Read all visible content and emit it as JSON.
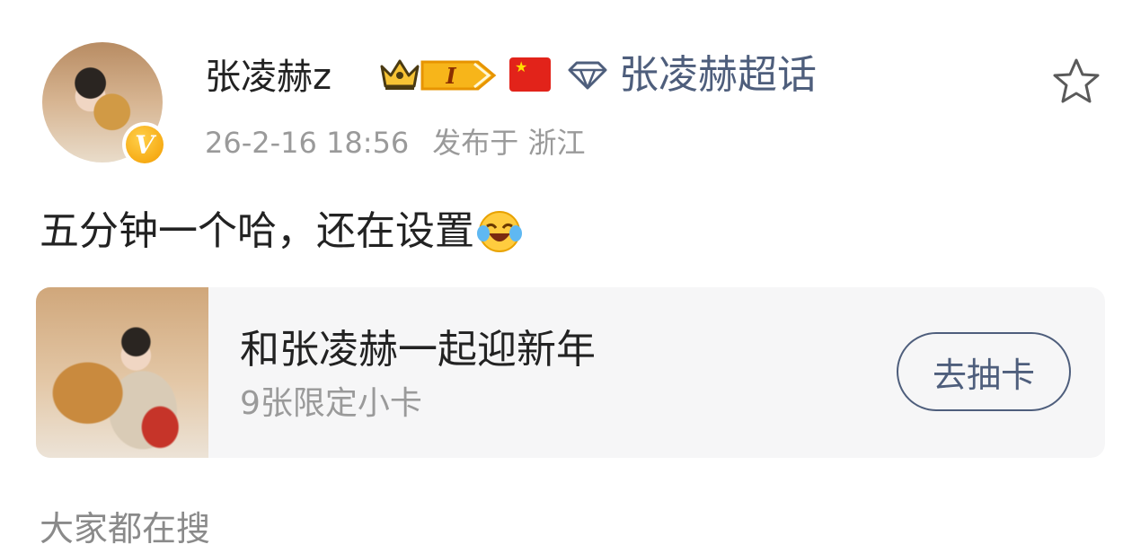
{
  "post": {
    "author": "张凌赫z",
    "level_badge": "I",
    "super_topic": "张凌赫超话",
    "timestamp": "26-2-16 18:56",
    "location_label": "发布于 浙江",
    "content_text": "五分钟一个哈，还在设置"
  },
  "card": {
    "title": "和张凌赫一起迎新年",
    "subtitle": "9张限定小卡",
    "button_label": "去抽卡"
  },
  "section": {
    "title": "大家都在搜"
  },
  "icons": {
    "verified": "verified-v-icon",
    "crown": "crown-icon",
    "flag": "china-flag-icon",
    "diamond": "diamond-icon",
    "favorite": "star-outline-icon",
    "emoji": "laugh-cry-emoji-icon"
  },
  "colors": {
    "link": "#4e5e7c",
    "muted": "#9a9a9a",
    "badge_gold": "#f5b400",
    "flag_red": "#e2231a"
  }
}
